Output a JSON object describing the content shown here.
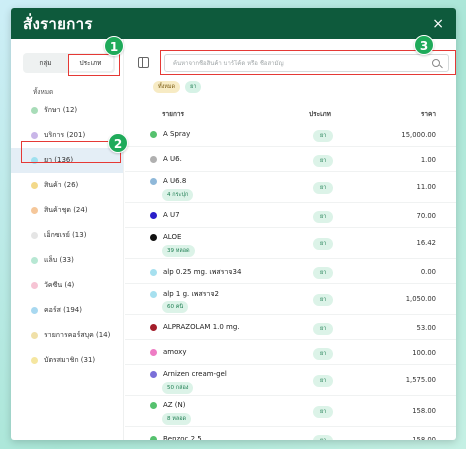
{
  "header": {
    "title": "สั่งรายการ",
    "close_icon": "×"
  },
  "sidebar": {
    "toggle": {
      "group_label": "กลุ่ม",
      "type_label": "ประเภท"
    },
    "all_label": "ทั้งหมด",
    "categories": [
      {
        "label": "รักษา (12)",
        "color": "#a8dcb8"
      },
      {
        "label": "บริการ (201)",
        "color": "#c9b6e8"
      },
      {
        "label": "ยา (136)",
        "color": "#9fe0ef"
      },
      {
        "label": "สินค้า (26)",
        "color": "#f3d98a"
      },
      {
        "label": "สินค้าชุด (24)",
        "color": "#f5c79a"
      },
      {
        "label": "เอ็กซเรย์ (13)",
        "color": "#e5e5e5"
      },
      {
        "label": "แล็บ (33)",
        "color": "#b7e7d3"
      },
      {
        "label": "วัคซีน (4)",
        "color": "#f6c4d4"
      },
      {
        "label": "คอร์ส (194)",
        "color": "#a8d8f0"
      },
      {
        "label": "รายการคอร์สบุค (14)",
        "color": "#f0e0a8"
      },
      {
        "label": "บัตรสมาชิก (31)",
        "color": "#f5e6a0"
      }
    ],
    "selected_index": 2
  },
  "search": {
    "placeholder": "ค้นหาจากชื่อสินค้า บาร์โค้ด หรือ ชื่อสามัญ"
  },
  "filters": {
    "all_chip": "ทั้งหมด",
    "type_chip": "ยา"
  },
  "table": {
    "headers": {
      "name": "รายการ",
      "type": "ประเภท",
      "price": "ราคา"
    },
    "rows": [
      {
        "name": "A Spray",
        "sub": "",
        "type": "ยา",
        "price": "15,000.00",
        "color": "#55c16e"
      },
      {
        "name": "A U6.",
        "sub": "",
        "type": "ยา",
        "price": "1.00",
        "color": "#b0b0b0"
      },
      {
        "name": "A U6.8",
        "sub": "4 กระปุก",
        "type": "ยา",
        "price": "11.00",
        "color": "#8fb8d9"
      },
      {
        "name": "A U7",
        "sub": "",
        "type": "ยา",
        "price": "70.00",
        "color": "#2a1ec9"
      },
      {
        "name": "ALOE",
        "sub": "39 หลอด",
        "type": "ยา",
        "price": "16.42",
        "color": "#111111"
      },
      {
        "name": "alp 0.25 mg. เพสราจ34",
        "sub": "",
        "type": "ยา",
        "price": "0.00",
        "color": "#a6e0ef"
      },
      {
        "name": "alp 1 g. เพสราจ2",
        "sub": "60 คนิ",
        "type": "ยา",
        "price": "1,050.00",
        "color": "#a6e0ef"
      },
      {
        "name": "ALPRAZOLAM 1.0 mg.",
        "sub": "",
        "type": "ยา",
        "price": "53.00",
        "color": "#a31d2a"
      },
      {
        "name": "amoxy",
        "sub": "",
        "type": "ยา",
        "price": "100.00",
        "color": "#ee7cc4"
      },
      {
        "name": "Arnizen cream-gel",
        "sub": "50 กล่อง",
        "type": "ยา",
        "price": "1,575.00",
        "color": "#7a6fd8"
      },
      {
        "name": "AZ (N)",
        "sub": "8 หลอด",
        "type": "ยา",
        "price": "158.00",
        "color": "#55c16e"
      },
      {
        "name": "Benzoc 2.5",
        "sub": "",
        "type": "ยา",
        "price": "158.00",
        "color": "#55c16e"
      }
    ]
  },
  "annotations": {
    "badge_1": "1",
    "badge_2": "2",
    "badge_3": "3"
  }
}
